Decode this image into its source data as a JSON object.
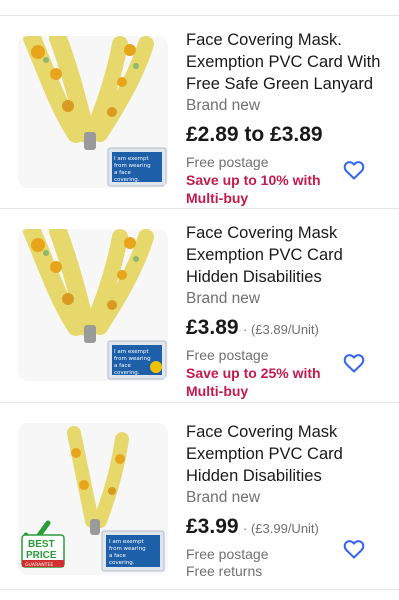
{
  "listings": [
    {
      "title": "Face Covering Mask. Exemption PVC Card With Free Safe Green Lanyard",
      "condition": "Brand new",
      "price": "£2.89 to £3.89",
      "unit_price": "",
      "shipping": "Free postage",
      "promo_line1": "Save up to 10% with",
      "promo_line2": "Multi-buy",
      "returns": "",
      "card_text": [
        "I am exempt",
        "from wearing",
        "a face",
        "covering."
      ]
    },
    {
      "title": "Face Covering Mask Exemption PVC Card Hidden Disabilities",
      "condition": "Brand new",
      "price": "£3.89",
      "unit_price": "· (£3.89/Unit)",
      "shipping": "Free postage",
      "promo_line1": "Save up to 25% with",
      "promo_line2": "Multi-buy",
      "returns": "",
      "card_text": [
        "I am exempt",
        "from wearing",
        "a face",
        "covering."
      ]
    },
    {
      "title": "Face Covering Mask Exemption PVC Card Hidden Disabilities",
      "condition": "Brand new",
      "price": "£3.99",
      "unit_price": "· (£3.99/Unit)",
      "shipping": "Free postage",
      "promo_line1": "",
      "promo_line2": "",
      "returns": "Free returns",
      "card_text": [
        "I am exempt",
        "from wearing",
        "a face",
        "covering."
      ],
      "badge": {
        "line1": "BEST",
        "line2": "PRICE",
        "line3": "GUARANTEE"
      }
    }
  ],
  "colors": {
    "promo": "#c41a4b",
    "heart": "#3665f3",
    "muted": "#707070",
    "text": "#191919"
  }
}
